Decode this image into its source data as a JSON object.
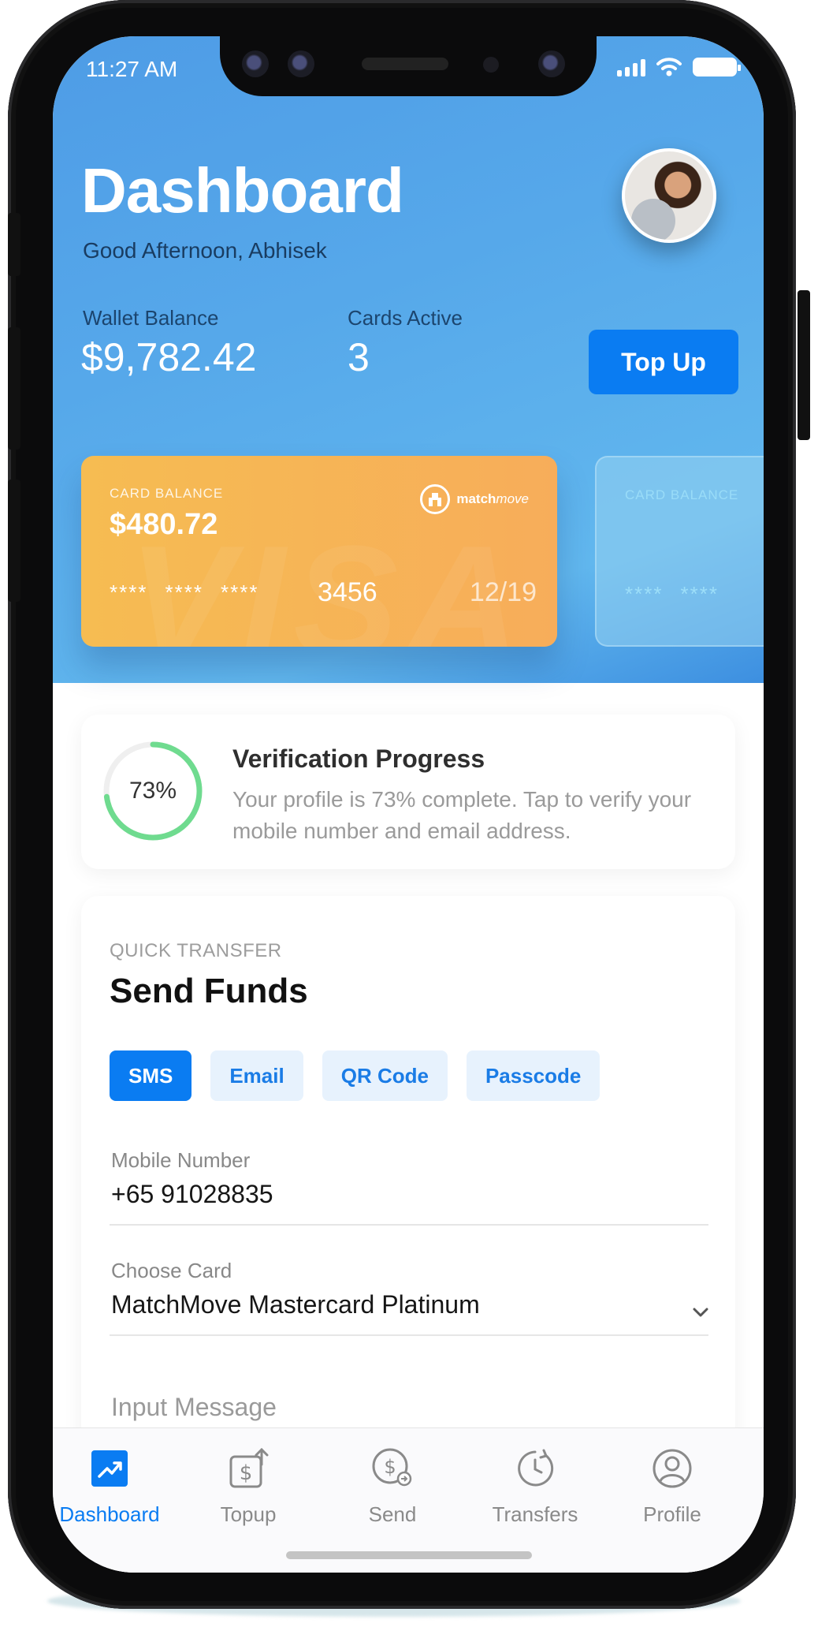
{
  "status_bar": {
    "time": "11:27 AM"
  },
  "header": {
    "title": "Dashboard",
    "greeting": "Good Afternoon, Abhisek",
    "wallet_balance_label": "Wallet Balance",
    "wallet_balance": "$9,782.42",
    "cards_active_label": "Cards Active",
    "cards_active": "3",
    "topup_label": "Top Up"
  },
  "cards": [
    {
      "label": "CARD BALANCE",
      "balance": "$480.72",
      "brand_watermark": "VISA",
      "masks": [
        "****",
        "****",
        "****"
      ],
      "last4": "3456",
      "expiry": "12/19",
      "issuer_name": "match",
      "issuer_name_italic": "move",
      "color": "#f6b655"
    },
    {
      "label": "CARD BALANCE",
      "masks": [
        "****",
        "****"
      ]
    }
  ],
  "verification": {
    "percent_text": "73%",
    "progress": 0.73,
    "title": "Verification Progress",
    "description": "Your profile is 73% complete. Tap to verify your mobile number and email address.",
    "color": "#6fdb8f"
  },
  "quick_transfer": {
    "eyebrow": "QUICK TRANSFER",
    "title": "Send Funds",
    "methods": [
      "SMS",
      "Email",
      "QR Code",
      "Passcode"
    ],
    "active_method": "SMS",
    "mobile_label": "Mobile Number",
    "mobile_value": "+65 91028835",
    "card_label": "Choose Card",
    "card_value": "MatchMove Mastercard Platinum",
    "message_placeholder": "Input Message"
  },
  "tabbar": {
    "items": [
      {
        "label": "Dashboard",
        "icon": "trending-up-icon"
      },
      {
        "label": "Topup",
        "icon": "wallet-topup-icon"
      },
      {
        "label": "Send",
        "icon": "send-money-icon"
      },
      {
        "label": "Transfers",
        "icon": "history-icon"
      },
      {
        "label": "Profile",
        "icon": "user-icon"
      }
    ],
    "active": "Dashboard"
  },
  "colors": {
    "accent": "#0a7cf2",
    "header_gradient_start": "#4e9ce6",
    "header_gradient_end": "#61b7ee"
  }
}
